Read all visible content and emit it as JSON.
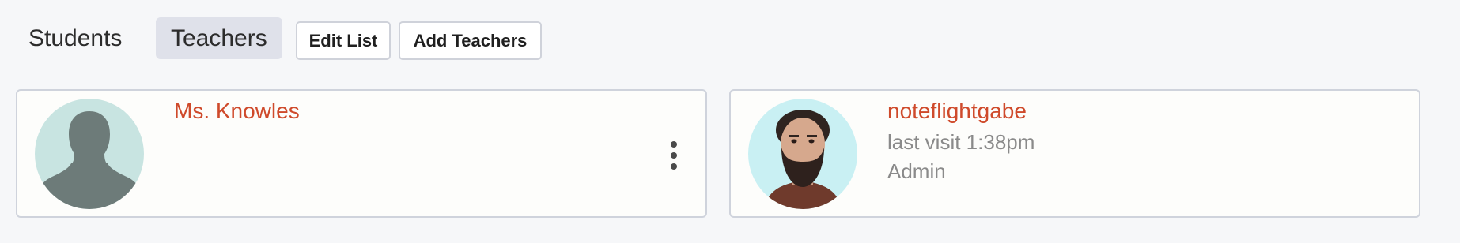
{
  "toolbar": {
    "tabs": [
      {
        "label": "Students",
        "active": false
      },
      {
        "label": "Teachers",
        "active": true
      }
    ],
    "edit_list_label": "Edit List",
    "add_teachers_label": "Add Teachers"
  },
  "teachers": [
    {
      "name": "Ms. Knowles",
      "avatar": "default-silhouette",
      "menu_icon": "vertical-ellipsis-icon"
    },
    {
      "name": "noteflightgabe",
      "last_visit": "last visit 1:38pm",
      "role": "Admin",
      "avatar": "user-photo"
    }
  ],
  "colors": {
    "accent": "#cf4a2b",
    "page_bg": "#f6f7f9",
    "active_tab_bg": "#dfe1ea",
    "card_border": "#cfd3dc",
    "muted_text": "#8a8a8a"
  }
}
